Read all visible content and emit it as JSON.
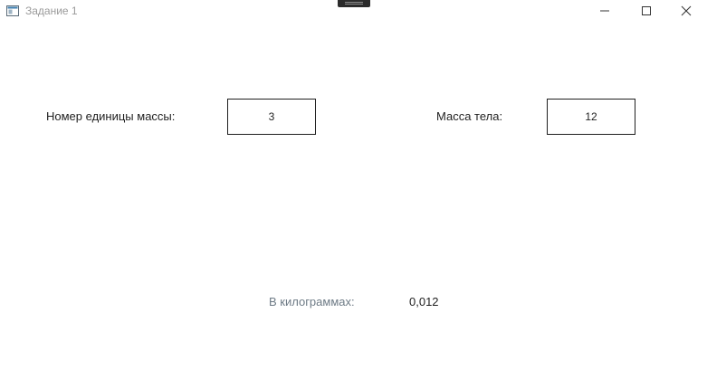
{
  "window": {
    "title": "Задание 1"
  },
  "form": {
    "unit_number_label": "Номер единицы массы:",
    "unit_number_value": "3",
    "mass_label": "Масса тела:",
    "mass_value": "12"
  },
  "result": {
    "label": "В килограммах:",
    "value": "0,012"
  },
  "colors": {
    "result_label": "#6e7b86",
    "border": "#1f1f1f",
    "title_text": "#9a9a9a"
  }
}
